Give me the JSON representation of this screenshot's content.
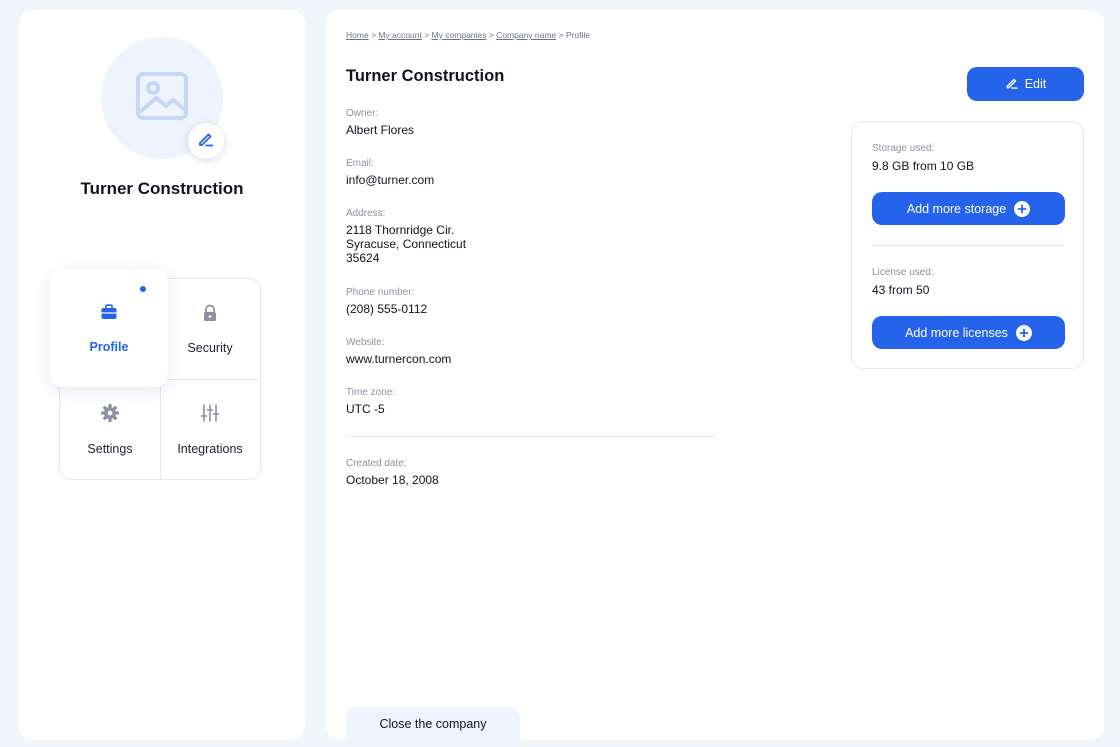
{
  "colors": {
    "accent": "#2563eb",
    "background": "#f1f5fc",
    "avatar_bg": "#eef3fd"
  },
  "sidebar": {
    "avatar_icon": "image-placeholder-icon",
    "avatar_edit_icon": "pencil-icon",
    "company_name": "Turner Construction",
    "nav": [
      {
        "label": "Profile",
        "icon": "briefcase-icon",
        "active": true
      },
      {
        "label": "Security",
        "icon": "lock-icon"
      },
      {
        "label": "Settings",
        "icon": "gear-icon"
      },
      {
        "label": "Integrations",
        "icon": "sliders-icon"
      }
    ]
  },
  "breadcrumb": {
    "home": "Home",
    "account": "My account",
    "companies": "My companies",
    "company": "Company name",
    "current": "Profile",
    "separator": ">"
  },
  "main": {
    "title": "Turner Construction",
    "edit_label": "Edit",
    "fields": {
      "owner": {
        "label": "Owner:",
        "value": "Albert Flores"
      },
      "email": {
        "label": "Email:",
        "value": "info@turner.com"
      },
      "address": {
        "label": "Address:",
        "value": "2118 Thornridge Cir.\nSyracuse, Connecticut\n35624"
      },
      "phone": {
        "label": "Phone number:",
        "value": "(208) 555-0112"
      },
      "website": {
        "label": "Website:",
        "value": "www.turnercon.com"
      },
      "timezone": {
        "label": "Time zone:",
        "value": "UTC -5"
      },
      "created": {
        "label": "Created date:",
        "value": "October 18, 2008"
      }
    },
    "close_label": "Close the company"
  },
  "usage": {
    "storage_label": "Storage used:",
    "storage_value": "9.8 GB from 10 GB",
    "storage_button": "Add more storage",
    "license_label": "License used:",
    "license_value": "43 from 50",
    "license_button": "Add more licenses"
  }
}
